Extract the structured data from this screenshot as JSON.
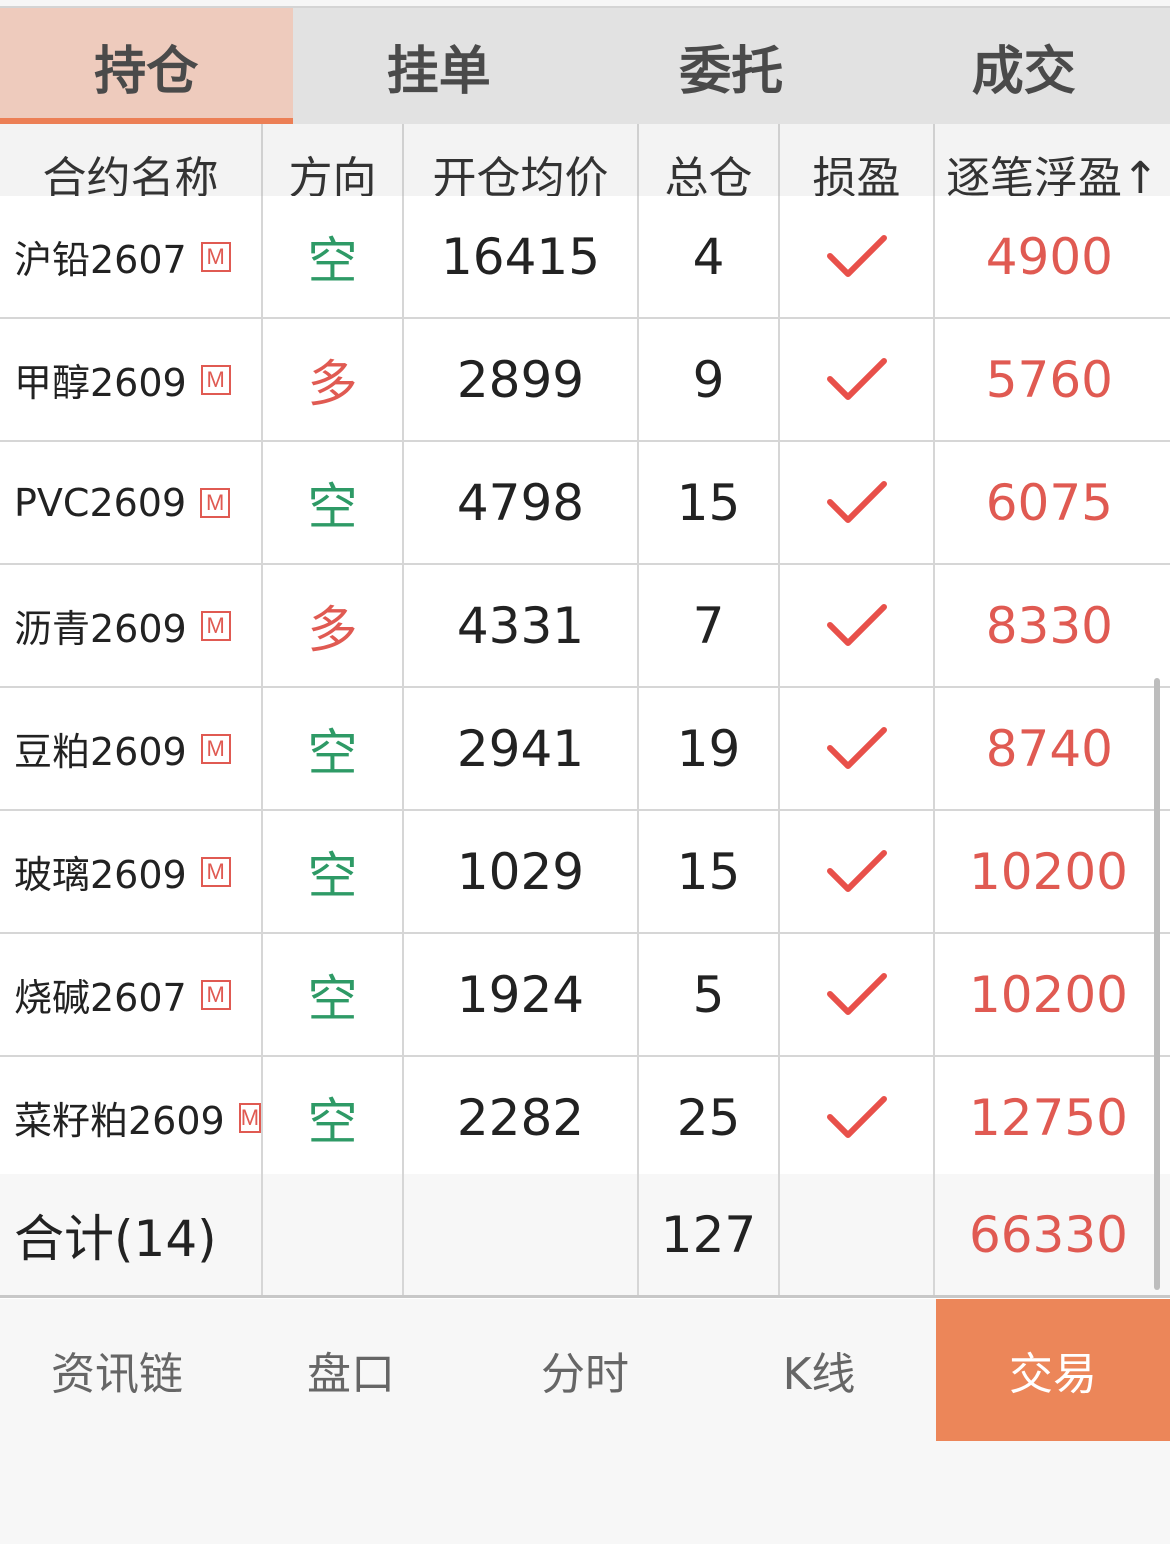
{
  "tabs": [
    {
      "label": "持仓",
      "active": true
    },
    {
      "label": "挂单",
      "active": false
    },
    {
      "label": "委托",
      "active": false
    },
    {
      "label": "成交",
      "active": false
    }
  ],
  "columns": [
    "合约名称",
    "方向",
    "开仓均价",
    "总仓",
    "损盈",
    "逐笔浮盈↑"
  ],
  "badge_text": "M",
  "rows": [
    {
      "name": "沪铅2607",
      "direction": "空",
      "dir_type": "short",
      "avg_price": "16415",
      "total": "4",
      "stop": "check",
      "pnl": "4900"
    },
    {
      "name": "甲醇2609",
      "direction": "多",
      "dir_type": "long",
      "avg_price": "2899",
      "total": "9",
      "stop": "check",
      "pnl": "5760"
    },
    {
      "name": "PVC2609",
      "direction": "空",
      "dir_type": "short",
      "avg_price": "4798",
      "total": "15",
      "stop": "check",
      "pnl": "6075"
    },
    {
      "name": "沥青2609",
      "direction": "多",
      "dir_type": "long",
      "avg_price": "4331",
      "total": "7",
      "stop": "check",
      "pnl": "8330"
    },
    {
      "name": "豆粕2609",
      "direction": "空",
      "dir_type": "short",
      "avg_price": "2941",
      "total": "19",
      "stop": "check",
      "pnl": "8740"
    },
    {
      "name": "玻璃2609",
      "direction": "空",
      "dir_type": "short",
      "avg_price": "1029",
      "total": "15",
      "stop": "check",
      "pnl": "10200"
    },
    {
      "name": "烧碱2607",
      "direction": "空",
      "dir_type": "short",
      "avg_price": "1924",
      "total": "5",
      "stop": "check",
      "pnl": "10200"
    },
    {
      "name": "菜籽粕2609",
      "direction": "空",
      "dir_type": "short",
      "avg_price": "2282",
      "total": "25",
      "stop": "check",
      "pnl": "12750"
    }
  ],
  "total_row": {
    "label": "合计(14)",
    "total": "127",
    "pnl": "66330"
  },
  "bottom_nav": [
    {
      "label": "资讯链",
      "active": false
    },
    {
      "label": "盘口",
      "active": false
    },
    {
      "label": "分时",
      "active": false
    },
    {
      "label": "K线",
      "active": false
    },
    {
      "label": "交易",
      "active": true
    }
  ],
  "colors": {
    "accent": "#ec8659",
    "profit": "#e05a52",
    "short": "#2e9a66",
    "long": "#e05a52"
  }
}
